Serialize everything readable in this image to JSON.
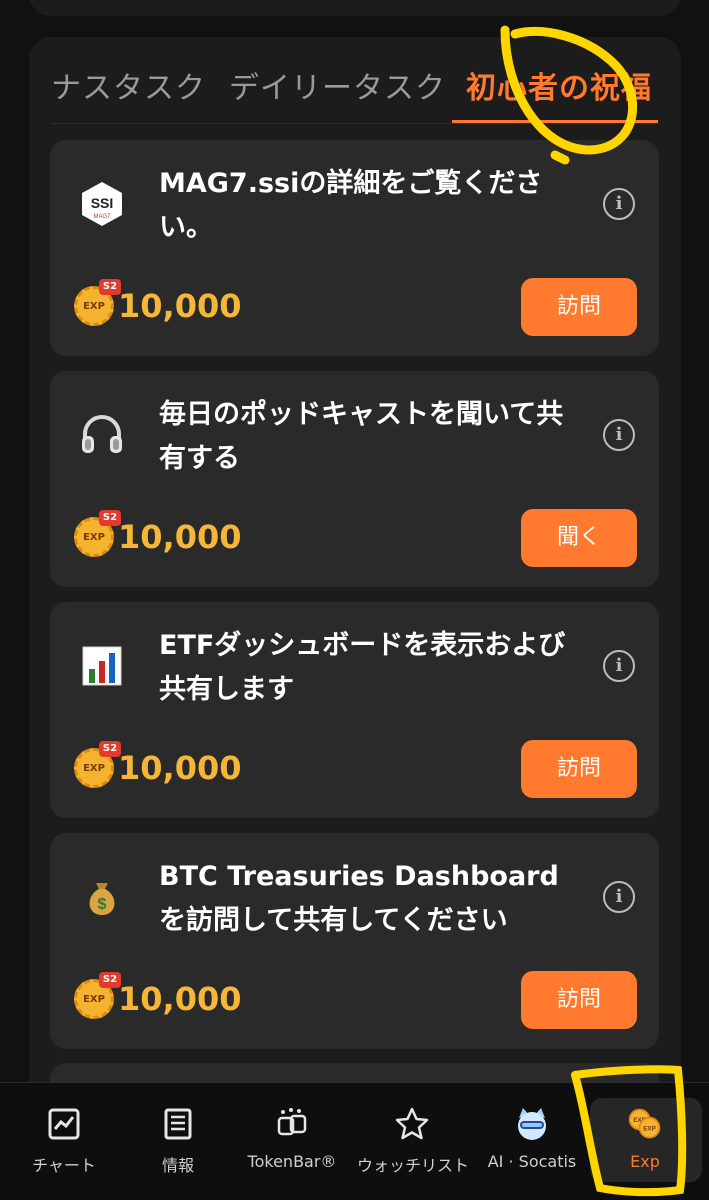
{
  "tabs": [
    {
      "label": "ナスタスク"
    },
    {
      "label": "デイリータスク"
    },
    {
      "label": "初心者の祝福",
      "active": true
    }
  ],
  "tasks": [
    {
      "icon": "mag7-ssi-logo-icon",
      "title": "MAG7.ssiの詳細をご覧ください。",
      "badge": "EXP",
      "season": "S2",
      "reward": "10,000",
      "button": "訪問"
    },
    {
      "icon": "headphones-icon",
      "title": "毎日のポッドキャストを聞いて共有する",
      "badge": "EXP",
      "season": "S2",
      "reward": "10,000",
      "button": "聞く"
    },
    {
      "icon": "bar-chart-icon",
      "title": "ETFダッシュボードを表示および共有します",
      "badge": "EXP",
      "season": "S2",
      "reward": "10,000",
      "button": "訪問"
    },
    {
      "icon": "money-bag-icon",
      "title": "BTC Treasuries Dashboardを訪問して共有してください",
      "badge": "EXP",
      "season": "S2",
      "reward": "10,000",
      "button": "訪問"
    }
  ],
  "ssi_logo": {
    "text": "SSI",
    "sub": "MAG7"
  },
  "nav": [
    {
      "label": "チャート",
      "icon": "chart-icon"
    },
    {
      "label": "情報",
      "icon": "news-icon"
    },
    {
      "label": "TokenBar®",
      "icon": "tokenbar-icon"
    },
    {
      "label": "ウォッチリスト",
      "icon": "star-icon"
    },
    {
      "label": "AI · Socatis",
      "icon": "ai-cat-icon"
    },
    {
      "label": "Exp",
      "icon": "exp-coins-icon",
      "active": true
    }
  ],
  "colors": {
    "accent": "#ff7a2f",
    "reward": "#f6b637",
    "card": "#2a2a2a",
    "annotation": "#ffd500"
  }
}
